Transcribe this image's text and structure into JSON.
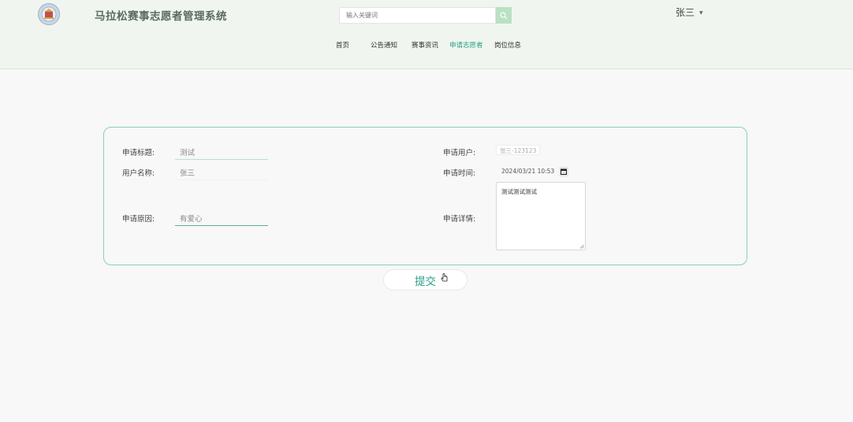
{
  "header": {
    "site_title": "马拉松赛事志愿者管理系统",
    "logo_icon": "emblem-icon",
    "search": {
      "placeholder": "输入关键词",
      "icon": "search-icon"
    },
    "user": {
      "name": "张三",
      "caret_icon": "caret-down-icon"
    },
    "nav": [
      {
        "label": "首页",
        "active": false
      },
      {
        "label": "公告通知",
        "active": false
      },
      {
        "label": "赛事资讯",
        "active": false
      },
      {
        "label": "申请志愿者",
        "active": true
      },
      {
        "label": "岗位信息",
        "active": false
      }
    ]
  },
  "form": {
    "title_label": "申请标题:",
    "title_value": "测试",
    "username_label": "用户名称:",
    "username_value": "张三",
    "reason_label": "申请原因:",
    "reason_value": "有爱心",
    "user_label": "申请用户:",
    "user_value": "张三-123123",
    "time_label": "申请时间:",
    "time_value": "2024/03/21 10:53",
    "detail_label": "申请详情:",
    "detail_value": "测试测试测试"
  },
  "submit_label": "提交",
  "colors": {
    "accent": "#2aa08a",
    "header_bg": "#f0f6ef",
    "card_border": "#8ecdbb"
  }
}
